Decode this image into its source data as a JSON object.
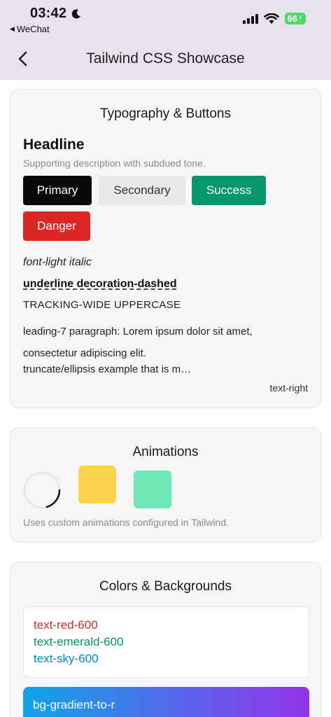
{
  "status_bar": {
    "time": "03:42",
    "back_app": "WeChat",
    "battery": "66"
  },
  "nav": {
    "title": "Tailwind CSS Showcase"
  },
  "typography": {
    "title": "Typography & Buttons",
    "headline": "Headline",
    "supporting": "Supporting description with subdued tone.",
    "buttons": {
      "primary": "Primary",
      "secondary": "Secondary",
      "success": "Success",
      "danger": "Danger"
    },
    "italic": "font-light italic",
    "underline": "underline decoration-dashed",
    "uppercase": "TRACKING-WIDE UPPERCASE",
    "leading": "leading-7 paragraph: Lorem ipsum dolor sit amet, consectetur adipiscing elit.",
    "truncate": "truncate/ellipsis example that is m…",
    "right": "text-right"
  },
  "animations": {
    "title": "Animations",
    "caption": "Uses custom animations configured in Tailwind."
  },
  "colors": {
    "title": "Colors & Backgrounds",
    "red": "text-red-600",
    "emerald": "text-emerald-600",
    "sky": "text-sky-600",
    "gradient": "bg-gradient-to-r",
    "palette": {
      "red": "#dc2626",
      "emerald": "#059669",
      "sky": "#0284c7",
      "gradient_from": "#0ea5e9",
      "gradient_to": "#9333ea",
      "nav_bg": "#e8e1ee"
    }
  }
}
